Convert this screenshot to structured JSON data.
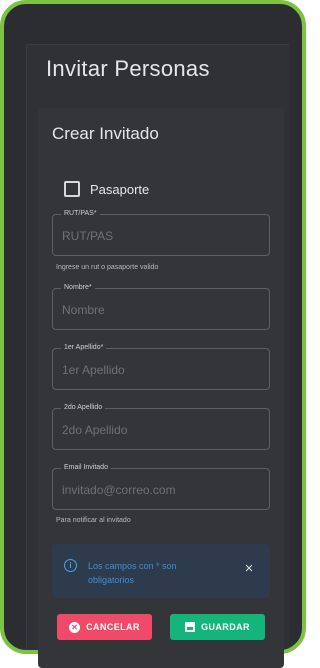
{
  "header": {
    "title": "Invitar Personas"
  },
  "card": {
    "title": "Crear Invitado",
    "passport_checkbox": {
      "label": "Pasaporte",
      "checked": false
    },
    "fields": [
      {
        "label": "RUT/PAS*",
        "placeholder": "RUT/PAS",
        "helper": "Ingrese un rut o pasaporte valido"
      },
      {
        "label": "Nombre*",
        "placeholder": "Nombre",
        "helper": ""
      },
      {
        "label": "1er Apellido*",
        "placeholder": "1er Apellido",
        "helper": ""
      },
      {
        "label": "2do Apellido",
        "placeholder": "2do Apellido",
        "helper": ""
      },
      {
        "label": "Email Invitado",
        "placeholder": "invitado@correo.com",
        "helper": "Para notificar al invitado"
      }
    ],
    "alert": {
      "text": "Los campos con * son obligatorios",
      "close": "×"
    },
    "buttons": {
      "cancel": "CANCELAR",
      "save": "GUARDAR"
    }
  },
  "colors": {
    "frame": "#7dc242",
    "cancel": "#ef4a6a",
    "save": "#13b57a",
    "info": "#4aa3f0"
  }
}
